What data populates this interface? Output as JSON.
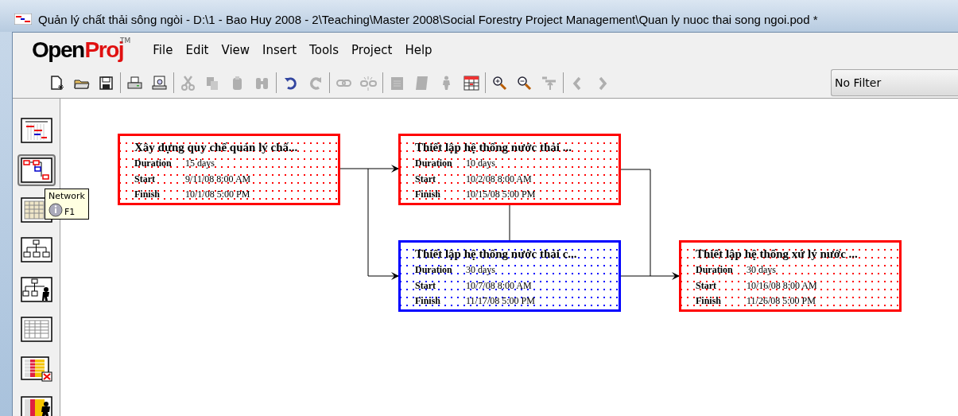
{
  "window": {
    "title": "Quản lý chất thải sông ngòi - D:\\1 - Bao Huy 2008 - 2\\Teaching\\Master 2008\\Social Forestry Project Management\\Quan ly nuoc thai song ngoi.pod *"
  },
  "logo": {
    "part_1": "Open",
    "part_2": "Proj",
    "mark": "TM"
  },
  "menu": [
    "File",
    "Edit",
    "View",
    "Insert",
    "Tools",
    "Project",
    "Help"
  ],
  "toolbar": [
    {
      "kind": "new",
      "disabled": false
    },
    {
      "kind": "open",
      "disabled": false
    },
    {
      "kind": "save",
      "disabled": false
    },
    {
      "kind": "sep"
    },
    {
      "kind": "print",
      "disabled": false
    },
    {
      "kind": "preview",
      "disabled": false
    },
    {
      "kind": "sep"
    },
    {
      "kind": "cut",
      "disabled": true
    },
    {
      "kind": "copy",
      "disabled": true
    },
    {
      "kind": "paste",
      "disabled": true
    },
    {
      "kind": "find",
      "disabled": true
    },
    {
      "kind": "sep"
    },
    {
      "kind": "undo",
      "disabled": false
    },
    {
      "kind": "redo",
      "disabled": true
    },
    {
      "kind": "sep"
    },
    {
      "kind": "link",
      "disabled": true
    },
    {
      "kind": "unlink",
      "disabled": true
    },
    {
      "kind": "sep"
    },
    {
      "kind": "info",
      "disabled": true
    },
    {
      "kind": "notes",
      "disabled": true
    },
    {
      "kind": "resource",
      "disabled": true
    },
    {
      "kind": "calendar",
      "disabled": false
    },
    {
      "kind": "sep"
    },
    {
      "kind": "zoomin",
      "disabled": false
    },
    {
      "kind": "zoomout",
      "disabled": false
    },
    {
      "kind": "scrolltask",
      "disabled": true
    },
    {
      "kind": "sep"
    },
    {
      "kind": "back",
      "disabled": true
    },
    {
      "kind": "forward",
      "disabled": true
    }
  ],
  "filter": {
    "value": "No Filter"
  },
  "views": [
    {
      "kind": "gantt",
      "selected": false
    },
    {
      "kind": "network",
      "selected": true
    },
    {
      "kind": "table",
      "selected": false
    },
    {
      "kind": "wbs",
      "selected": false
    },
    {
      "kind": "rbs",
      "selected": false
    },
    {
      "kind": "sheet",
      "selected": false
    },
    {
      "kind": "usage",
      "selected": false
    },
    {
      "kind": "resusage",
      "selected": false
    }
  ],
  "tooltip": {
    "title": "Network",
    "shortcut": "F1"
  },
  "nodes": [
    {
      "title": "Xây dựng quy chế quản lý chấ...",
      "critical": true,
      "fields": [
        {
          "label": "Duration",
          "value": "15 days"
        },
        {
          "label": "Start",
          "value": "9/11/08 8:00 AM"
        },
        {
          "label": "Finish",
          "value": "10/1/08 5:00 PM"
        }
      ]
    },
    {
      "title": "Thiết lập hệ thống nước thải ...",
      "critical": true,
      "fields": [
        {
          "label": "Duration",
          "value": "10 days"
        },
        {
          "label": "Start",
          "value": "10/2/08 8:00 AM"
        },
        {
          "label": "Finish",
          "value": "10/15/08 5:00 PM"
        }
      ]
    },
    {
      "title": "Thiết lập hệ thống nước thải c...",
      "critical": false,
      "fields": [
        {
          "label": "Duration",
          "value": "30 days"
        },
        {
          "label": "Start",
          "value": "10/7/08 8:00 AM"
        },
        {
          "label": "Finish",
          "value": "11/17/08 5:00 PM"
        }
      ]
    },
    {
      "title": "Thiết lập hệ thống xử lý nước ...",
      "critical": true,
      "fields": [
        {
          "label": "Duration",
          "value": "30 days"
        },
        {
          "label": "Start",
          "value": "10/16/08 8:00 AM"
        },
        {
          "label": "Finish",
          "value": "11/26/08 5:00 PM"
        }
      ]
    }
  ]
}
